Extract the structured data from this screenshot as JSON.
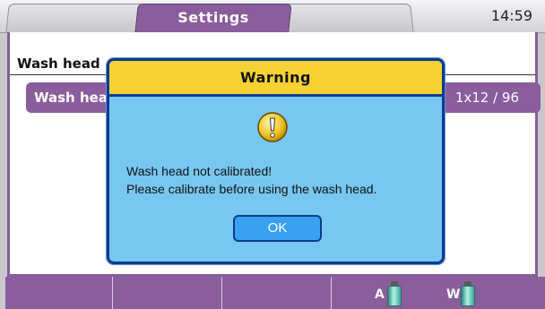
{
  "header": {
    "active_tab": "Settings",
    "time": "14:59"
  },
  "panel": {
    "section_title": "Wash head",
    "row_label": "Wash hea",
    "row_value": "1x12 / 96"
  },
  "reagents": [
    {
      "label": "A",
      "icon": "bottle-icon"
    },
    {
      "label": "W",
      "icon": "bottle-icon"
    }
  ],
  "dialog": {
    "title": "Warning",
    "icon": "exclamation-icon",
    "message_line1": "Wash head not calibrated!",
    "message_line2": "Please calibrate before using the wash head.",
    "ok_label": "OK"
  },
  "colors": {
    "accent_purple": "#8a5d9d",
    "dialog_title_bg": "#f7d235",
    "dialog_body_bg": "#78c7f0",
    "ok_button": "#3aa0f0",
    "dialog_border": "#0b3b8f"
  }
}
